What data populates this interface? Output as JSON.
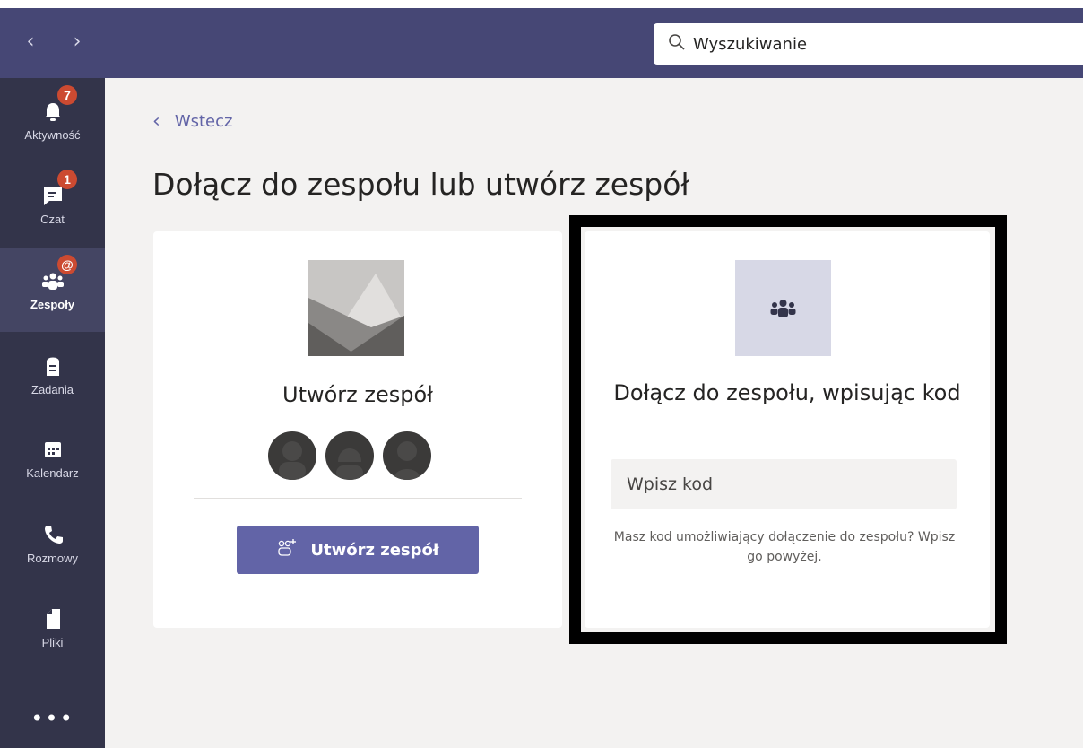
{
  "search": {
    "placeholder": "Wyszukiwanie"
  },
  "rail": {
    "items": [
      {
        "label": "Aktywność",
        "icon": "bell-icon",
        "badge": "7"
      },
      {
        "label": "Czat",
        "icon": "chat-icon",
        "badge": "1"
      },
      {
        "label": "Zespoły",
        "icon": "teams-icon",
        "badge": "@"
      },
      {
        "label": "Zadania",
        "icon": "assignments-icon"
      },
      {
        "label": "Kalendarz",
        "icon": "calendar-icon"
      },
      {
        "label": "Rozmowy",
        "icon": "phone-icon"
      },
      {
        "label": "Pliki",
        "icon": "file-icon"
      }
    ],
    "more": "•••"
  },
  "main": {
    "back": "Wstecz",
    "title": "Dołącz do zespołu lub utwórz zespół",
    "create": {
      "title": "Utwórz zespół",
      "button": "Utwórz zespół"
    },
    "join": {
      "title": "Dołącz do zespołu, wpisując kod",
      "placeholder": "Wpisz kod",
      "hint": "Masz kod umożliwiający dołączenie do zespołu? Wpisz go powyżej."
    }
  },
  "colors": {
    "accent": "#6264a7",
    "titlebar": "#464775",
    "rail": "#33344a",
    "badge": "#cc4a31"
  }
}
